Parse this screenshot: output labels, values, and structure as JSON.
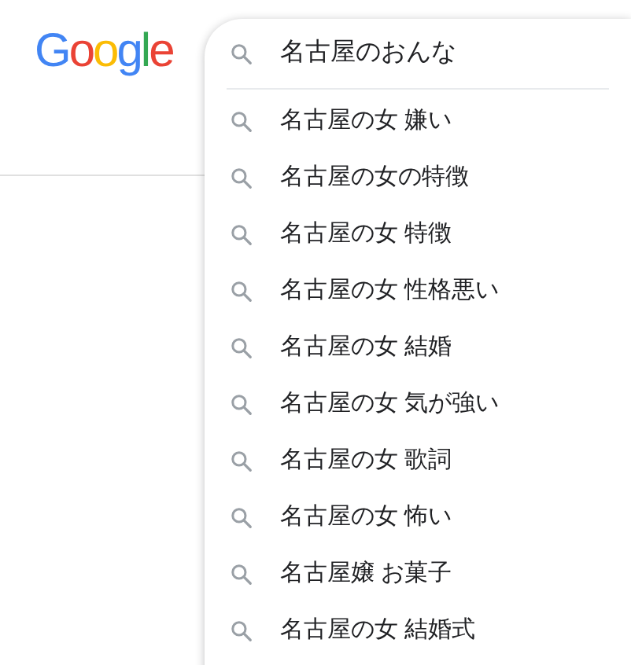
{
  "logo": "Google",
  "search": {
    "value": "名古屋のおんな"
  },
  "suggestions": [
    "名古屋の女 嫌い",
    "名古屋の女の特徴",
    "名古屋の女 特徴",
    "名古屋の女 性格悪い",
    "名古屋の女 結婚",
    "名古屋の女 気が強い",
    "名古屋の女 歌詞",
    "名古屋の女 怖い",
    "名古屋嬢 お菓子",
    "名古屋の女 結婚式"
  ]
}
